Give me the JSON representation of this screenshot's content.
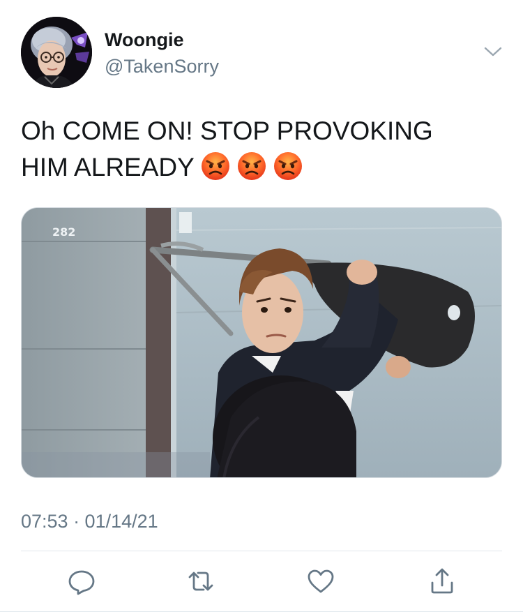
{
  "user": {
    "display_name": "Woongie",
    "handle": "@TakenSorry",
    "avatar_icon": "profile-photo"
  },
  "tweet": {
    "text_line1": "Oh COME ON! STOP PROVOKING",
    "text_line2": "HIM ALREADY",
    "emoji": [
      "angry-face",
      "angry-face",
      "angry-face"
    ],
    "media_caption_sign": "282",
    "timestamp": "07:53 · 01/14/21"
  },
  "actions": [
    {
      "name": "reply",
      "icon": "reply-icon"
    },
    {
      "name": "retweet",
      "icon": "retweet-icon"
    },
    {
      "name": "like",
      "icon": "heart-icon"
    },
    {
      "name": "share",
      "icon": "share-icon"
    }
  ],
  "colors": {
    "primary_text": "#14171a",
    "secondary_text": "#657786",
    "divider": "#e1e8ed",
    "icon": "#657786"
  }
}
